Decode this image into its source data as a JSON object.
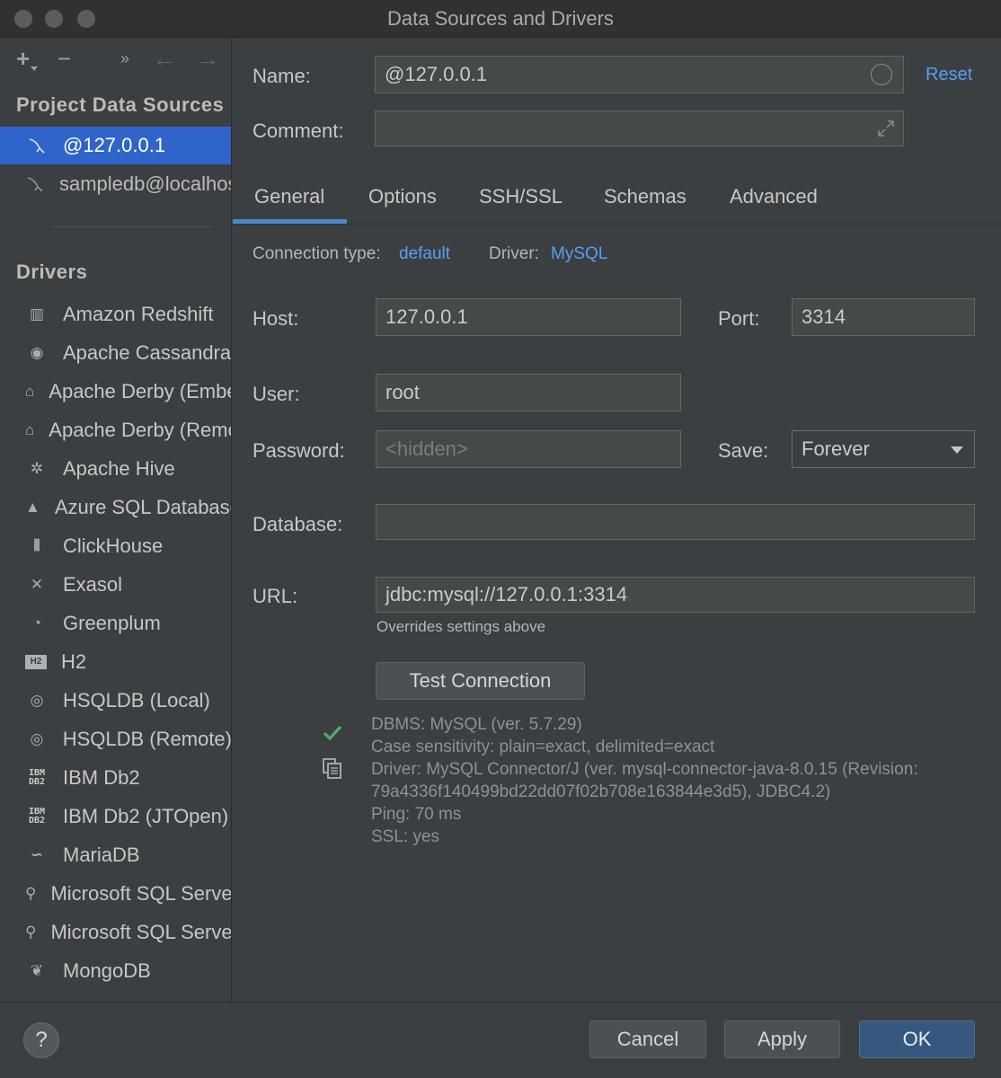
{
  "window": {
    "title": "Data Sources and Drivers"
  },
  "sidebar": {
    "toolbar": {
      "add": "+",
      "remove": "−",
      "more": "»",
      "back": "←",
      "forward": "→"
    },
    "project_header": "Project Data Sources",
    "data_sources": [
      {
        "label": "@127.0.0.1"
      },
      {
        "label": "sampledb@localhost"
      }
    ],
    "drivers_header": "Drivers",
    "drivers": [
      {
        "label": "Amazon Redshift",
        "icon": "redshift-icon"
      },
      {
        "label": "Apache Cassandra",
        "icon": "cassandra-icon"
      },
      {
        "label": "Apache Derby (Embedded)",
        "icon": "derby-icon"
      },
      {
        "label": "Apache Derby (Remote)",
        "icon": "derby-icon"
      },
      {
        "label": "Apache Hive",
        "icon": "hive-icon"
      },
      {
        "label": "Azure SQL Database",
        "icon": "azure-icon"
      },
      {
        "label": "ClickHouse",
        "icon": "clickhouse-icon"
      },
      {
        "label": "Exasol",
        "icon": "exasol-icon"
      },
      {
        "label": "Greenplum",
        "icon": "greenplum-icon"
      },
      {
        "label": "H2",
        "icon": "h2-icon"
      },
      {
        "label": "HSQLDB (Local)",
        "icon": "hsqldb-icon"
      },
      {
        "label": "HSQLDB (Remote)",
        "icon": "hsqldb-icon"
      },
      {
        "label": "IBM Db2",
        "icon": "ibm-db2-icon"
      },
      {
        "label": "IBM Db2 (JTOpen)",
        "icon": "ibm-db2-icon"
      },
      {
        "label": "MariaDB",
        "icon": "mariadb-icon"
      },
      {
        "label": "Microsoft SQL Server",
        "icon": "mssql-icon"
      },
      {
        "label": "Microsoft SQL Server",
        "icon": "mssql-icon"
      },
      {
        "label": "MongoDB",
        "icon": "mongodb-icon"
      }
    ],
    "ibm_glyph": "IBM\nDB2",
    "h2_glyph": "H2"
  },
  "form": {
    "name_label": "Name:",
    "name_value": "@127.0.0.1",
    "reset": "Reset",
    "comment_label": "Comment:",
    "comment_value": "",
    "tabs": [
      "General",
      "Options",
      "SSH/SSL",
      "Schemas",
      "Advanced"
    ],
    "connection_type_label": "Connection type:",
    "connection_type_value": "default",
    "driver_label": "Driver:",
    "driver_value": "MySQL",
    "host_label": "Host:",
    "host_value": "127.0.0.1",
    "port_label": "Port:",
    "port_value": "3314",
    "user_label": "User:",
    "user_value": "root",
    "password_label": "Password:",
    "password_placeholder": "<hidden>",
    "save_label": "Save:",
    "save_value": "Forever",
    "database_label": "Database:",
    "database_value": "",
    "url_label": "URL:",
    "url_value": "jdbc:mysql://127.0.0.1:3314",
    "url_hint": "Overrides settings above",
    "test_button": "Test Connection",
    "test_result": [
      "DBMS: MySQL (ver. 5.7.29)",
      "Case sensitivity: plain=exact, delimited=exact",
      "Driver: MySQL Connector/J (ver. mysql-connector-java-8.0.15 (Revision:",
      "79a4336f140499bd22dd07f02b708e163844e3d5), JDBC4.2)",
      "Ping: 70 ms",
      "SSL: yes"
    ]
  },
  "footer": {
    "help": "?",
    "cancel": "Cancel",
    "apply": "Apply",
    "ok": "OK"
  },
  "colors": {
    "accent": "#589df6",
    "selection": "#2f65ca",
    "success": "#59a869",
    "primary_button": "#365880"
  }
}
